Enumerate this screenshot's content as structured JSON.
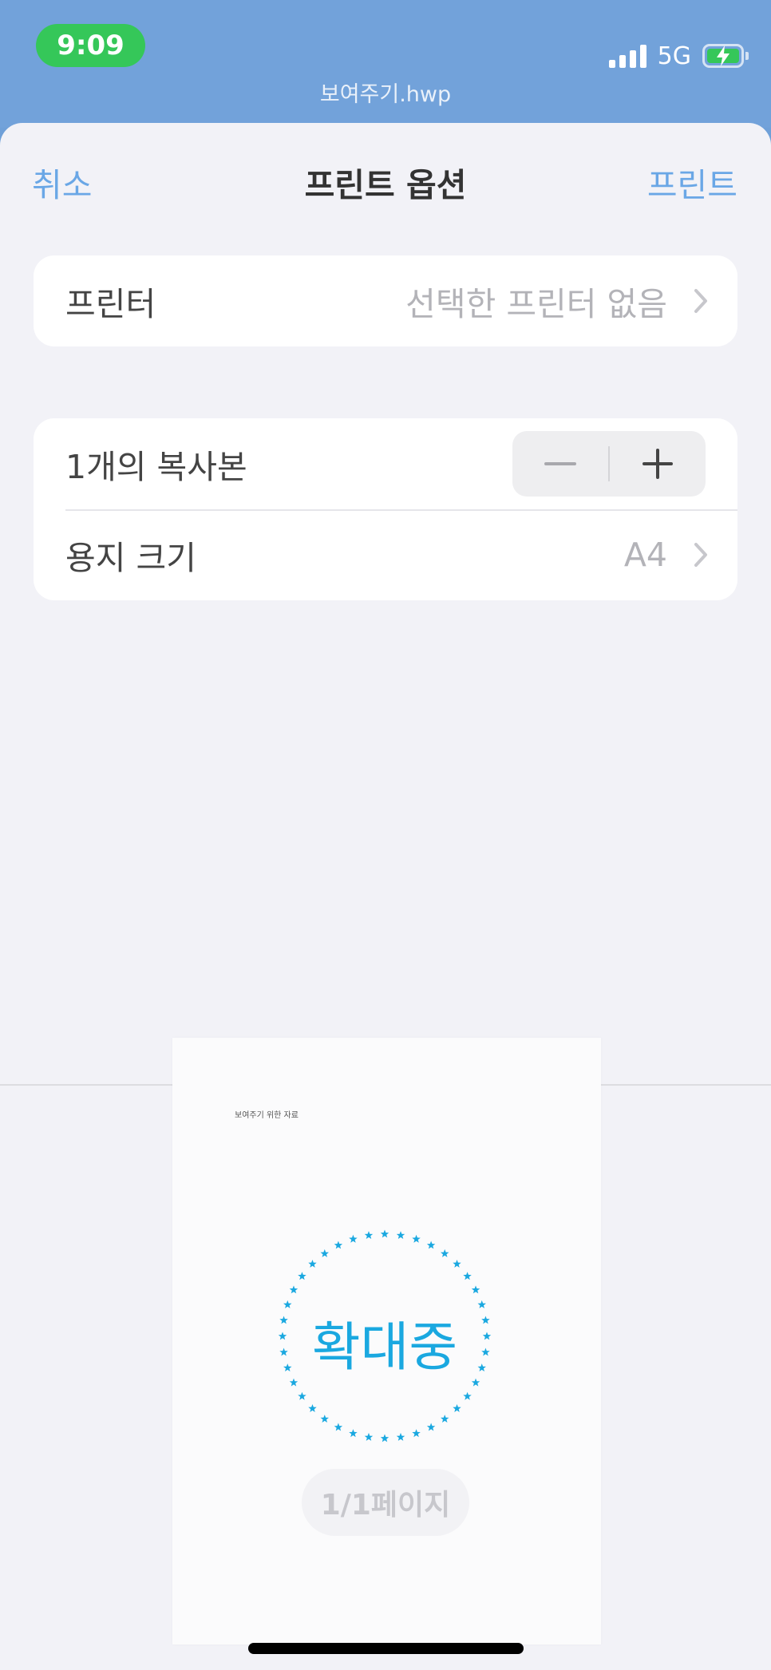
{
  "status_bar": {
    "time": "9:09",
    "network": "5G",
    "document_name": "보여주기.hwp"
  },
  "nav": {
    "cancel_label": "취소",
    "title": "프린트 옵션",
    "print_label": "프린트"
  },
  "printer_row": {
    "label": "프린터",
    "value": "선택한 프린터 없음"
  },
  "copies_row": {
    "label": "1개의 복사본"
  },
  "paper_row": {
    "label": "용지 크기",
    "value": "A4"
  },
  "preview": {
    "header_text": "보여주기 위한 자료",
    "stamp_text": "확대중",
    "page_indicator": "1/1페이지"
  },
  "colors": {
    "accent": "#6aa7e6",
    "status_green": "#35c759",
    "stamp_blue": "#1aa8e0"
  }
}
